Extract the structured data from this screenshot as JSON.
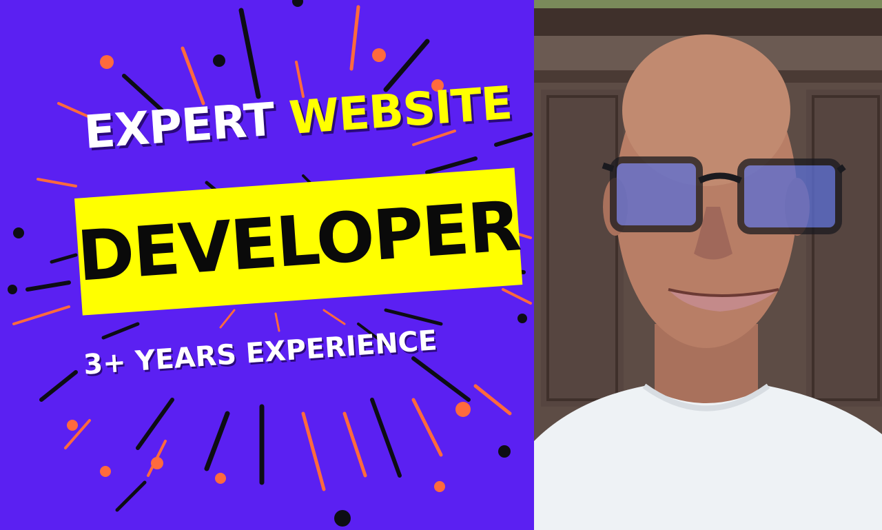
{
  "headline": {
    "word1": "EXPERT",
    "word2": "WEBSITE"
  },
  "banner": {
    "text": "DEVELOPER"
  },
  "subline": {
    "text": "3+ YEARS EXPERIENCE"
  },
  "colors": {
    "background": "#5b20f2",
    "highlight": "#ffff00",
    "accent_orange": "#ff6a3d",
    "ink": "#0a0a0a",
    "white": "#ffffff"
  },
  "photo": {
    "subject": "portrait-of-smiling-man-with-glasses"
  }
}
